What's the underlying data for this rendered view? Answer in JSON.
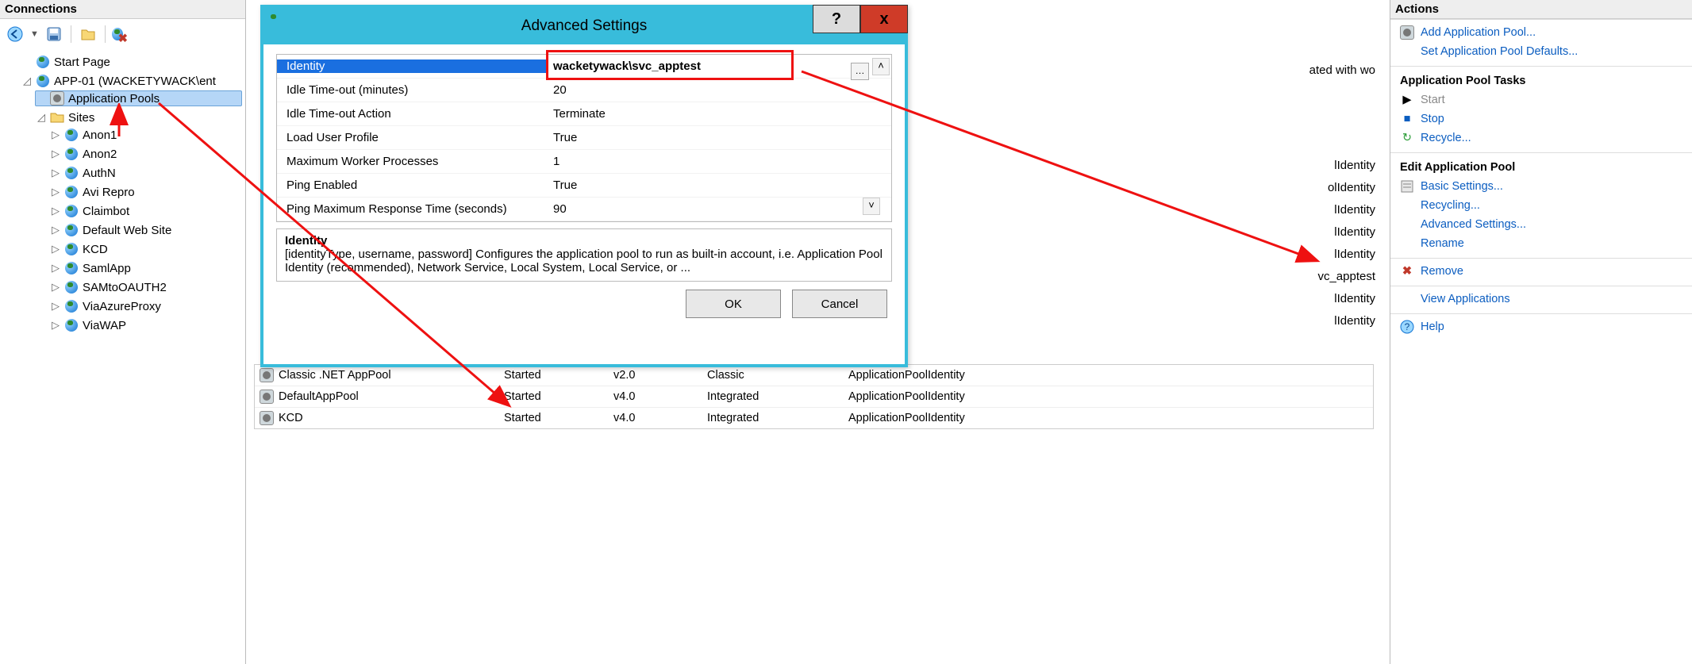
{
  "left": {
    "title": "Connections",
    "tree": {
      "start_page": "Start Page",
      "server": "APP-01 (WACKETYWACK\\ent",
      "app_pools": "Application Pools",
      "sites_label": "Sites",
      "sites": [
        "Anon1",
        "Anon2",
        "AuthN",
        "Avi Repro",
        "Claimbot",
        "Default Web Site",
        "KCD",
        "SamlApp",
        "SAMtoOAUTH2",
        "ViaAzureProxy",
        "ViaWAP"
      ]
    }
  },
  "dialog": {
    "title": "Advanced Settings",
    "help": "?",
    "close": "x",
    "rows": [
      {
        "k": "Identity",
        "v": "wacketywack\\svc_apptest",
        "selected": true,
        "browse": true
      },
      {
        "k": "Idle Time-out (minutes)",
        "v": "20"
      },
      {
        "k": "Idle Time-out Action",
        "v": "Terminate"
      },
      {
        "k": "Load User Profile",
        "v": "True"
      },
      {
        "k": "Maximum Worker Processes",
        "v": "1"
      },
      {
        "k": "Ping Enabled",
        "v": "True"
      },
      {
        "k": "Ping Maximum Response Time (seconds)",
        "v": "90"
      }
    ],
    "desc_title": "Identity",
    "desc_body": "[identityType, username, password] Configures the application pool to run as built-in account, i.e. Application Pool Identity (recommended), Network Service, Local System, Local Service, or ...",
    "ok": "OK",
    "cancel": "Cancel"
  },
  "center": {
    "behind_hint": "ated with wo",
    "behind_identities": [
      "lIdentity",
      "olIdentity",
      "lIdentity",
      "lIdentity",
      "lIdentity",
      "vc_apptest",
      "lIdentity",
      "lIdentity"
    ],
    "grid": [
      {
        "name": "Classic .NET AppPool",
        "status": "Started",
        "ver": "v2.0",
        "mode": "Classic",
        "id": "ApplicationPoolIdentity"
      },
      {
        "name": "DefaultAppPool",
        "status": "Started",
        "ver": "v4.0",
        "mode": "Integrated",
        "id": "ApplicationPoolIdentity"
      },
      {
        "name": "KCD",
        "status": "Started",
        "ver": "v4.0",
        "mode": "Integrated",
        "id": "ApplicationPoolIdentity"
      }
    ]
  },
  "right": {
    "title": "Actions",
    "add_pool": "Add Application Pool...",
    "set_defaults": "Set Application Pool Defaults...",
    "tasks_title": "Application Pool Tasks",
    "start": "Start",
    "stop": "Stop",
    "recycle": "Recycle...",
    "edit_title": "Edit Application Pool",
    "basic": "Basic Settings...",
    "recycling": "Recycling...",
    "advanced": "Advanced Settings...",
    "rename": "Rename",
    "remove": "Remove",
    "view_apps": "View Applications",
    "help": "Help"
  }
}
